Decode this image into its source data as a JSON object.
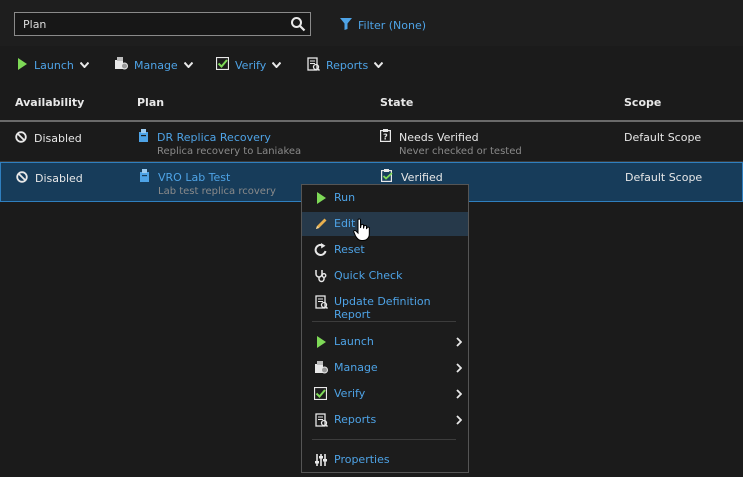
{
  "search": {
    "value": "Plan",
    "placeholder": ""
  },
  "filter": {
    "label": "Filter (None)"
  },
  "toolbar": [
    {
      "label": "Launch",
      "icon": "play-icon"
    },
    {
      "label": "Manage",
      "icon": "manage-icon"
    },
    {
      "label": "Verify",
      "icon": "checkbox-icon"
    },
    {
      "label": "Reports",
      "icon": "report-icon"
    }
  ],
  "table": {
    "headers": [
      "Availability",
      "Plan",
      "State",
      "Scope"
    ],
    "rows": [
      {
        "availability": "Disabled",
        "plan": "DR Replica Recovery",
        "plan_desc": "Replica recovery to Laniakea",
        "state": "Needs Verified",
        "state_desc": "Never checked or tested",
        "scope": "Default Scope"
      },
      {
        "availability": "Disabled",
        "plan": "VRO Lab Test",
        "plan_desc": "Lab test replica rcovery",
        "state": "Verified",
        "state_desc": "",
        "scope": "Default Scope"
      }
    ]
  },
  "context_menu": {
    "items": [
      {
        "label": "Run",
        "icon": "play-icon"
      },
      {
        "label": "Edit",
        "icon": "pencil-icon"
      },
      {
        "label": "Reset",
        "icon": "reset-icon"
      },
      {
        "label": "Quick Check",
        "icon": "stethoscope-icon"
      },
      {
        "label": "Update Definition Report",
        "icon": "report-icon"
      },
      {
        "label": "Launch",
        "icon": "play-icon"
      },
      {
        "label": "Manage",
        "icon": "manage-icon"
      },
      {
        "label": "Verify",
        "icon": "checkbox-icon"
      },
      {
        "label": "Reports",
        "icon": "report-icon"
      },
      {
        "label": "Properties",
        "icon": "sliders-icon"
      }
    ]
  },
  "colors": {
    "accent": "#4ea3e6",
    "play": "#7ed957",
    "selected_row": "#173c5a",
    "hover_item": "#26394a"
  }
}
